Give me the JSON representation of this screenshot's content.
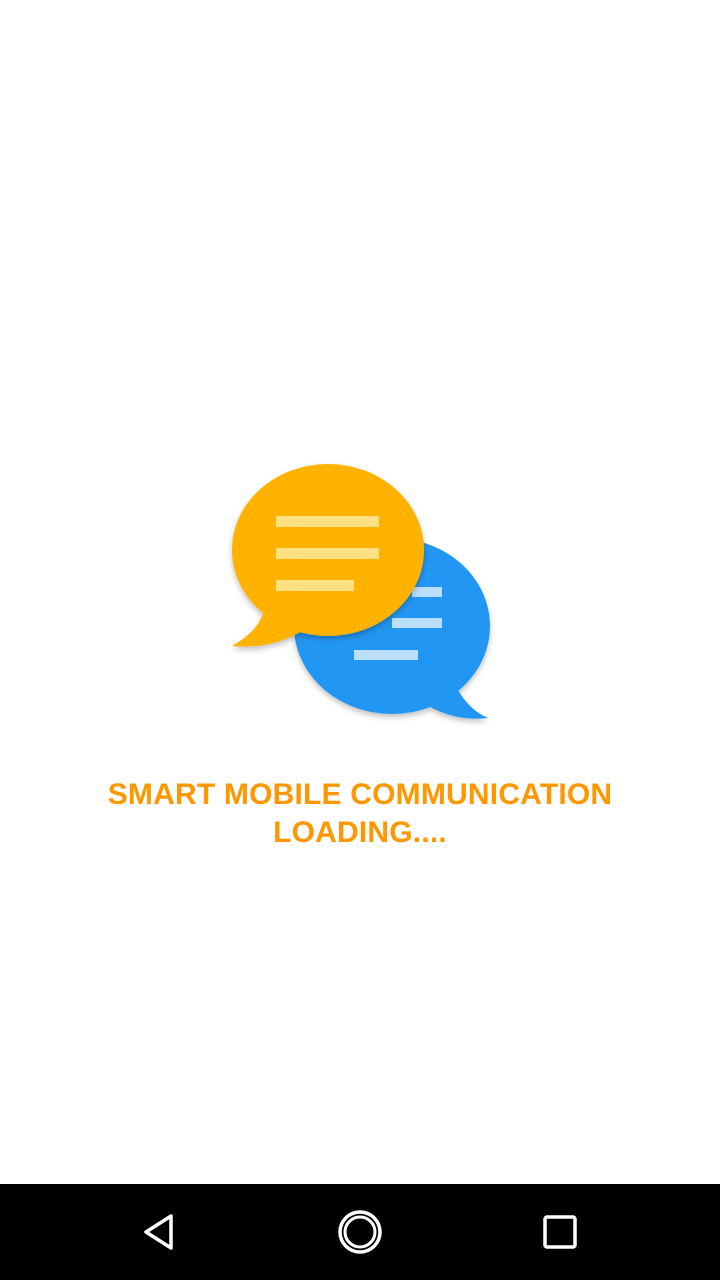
{
  "app": {
    "title_line": "SMART MOBILE COMMUNICATION",
    "status_line": "LOADING....",
    "logo_icon": "chat-bubbles-icon"
  },
  "colors": {
    "accent": "#FF9800",
    "bubble_front": "#FFB300",
    "bubble_back": "#2196F3",
    "nav_bar": "#000000"
  },
  "nav_bar": {
    "buttons": [
      {
        "icon": "back-triangle-icon"
      },
      {
        "icon": "home-circle-icon"
      },
      {
        "icon": "recents-square-icon"
      }
    ]
  }
}
